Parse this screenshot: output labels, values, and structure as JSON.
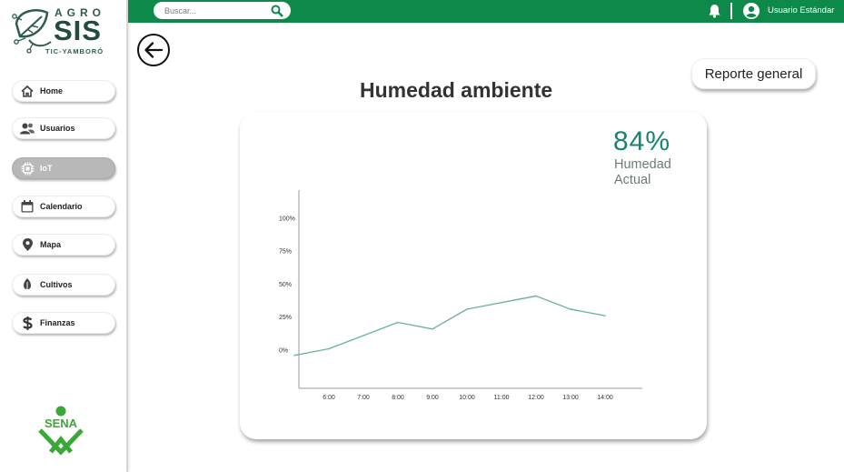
{
  "header": {
    "search_placeholder": "Buscar...",
    "user_name": "Usuario Estándar"
  },
  "logo": {
    "brand_top": "AGRO",
    "brand_main": "SIS",
    "brand_sub": "TIC-YAMBORÓ"
  },
  "sidebar": {
    "items": [
      {
        "label": "Home",
        "icon": "home-icon"
      },
      {
        "label": "Usuarios",
        "icon": "users-icon"
      },
      {
        "label": "IoT",
        "icon": "chip-icon",
        "active": true
      },
      {
        "label": "Calendario",
        "icon": "calendar-icon"
      },
      {
        "label": "Mapa",
        "icon": "map-pin-icon"
      },
      {
        "label": "Cultivos",
        "icon": "leaf-icon"
      },
      {
        "label": "Finanzas",
        "icon": "dollar-icon"
      }
    ],
    "footer_logo": "SENA"
  },
  "main": {
    "title": "Humedad ambiente",
    "report_button": "Reporte general",
    "current_value": "84%",
    "current_label": "Humedad Actual"
  },
  "colors": {
    "primary_green": "#0d8a4a",
    "accent_teal": "#16846f",
    "line_color": "#6fb1a8",
    "active_nav": "#b8b8b8"
  },
  "chart_data": {
    "type": "line",
    "title": "",
    "xlabel": "",
    "ylabel": "",
    "categories": [
      "6:00",
      "7:00",
      "8:00",
      "9:00",
      "10:00",
      "11:00",
      "12:00",
      "13:00",
      "14:00"
    ],
    "y_ticks": [
      "100%",
      "75%",
      "50%",
      "25%",
      "0%"
    ],
    "ylim": [
      0,
      100
    ],
    "points": [
      {
        "x": "5:00",
        "y": -4
      },
      {
        "x": "6:00",
        "y": 1
      },
      {
        "x": "7:00",
        "y": 11
      },
      {
        "x": "8:00",
        "y": 21
      },
      {
        "x": "9:00",
        "y": 16
      },
      {
        "x": "10:00",
        "y": 31
      },
      {
        "x": "11:00",
        "y": 36
      },
      {
        "x": "12:00",
        "y": 41
      },
      {
        "x": "13:00",
        "y": 31
      },
      {
        "x": "14:00",
        "y": 26
      }
    ],
    "grid": false,
    "legend": "none"
  }
}
